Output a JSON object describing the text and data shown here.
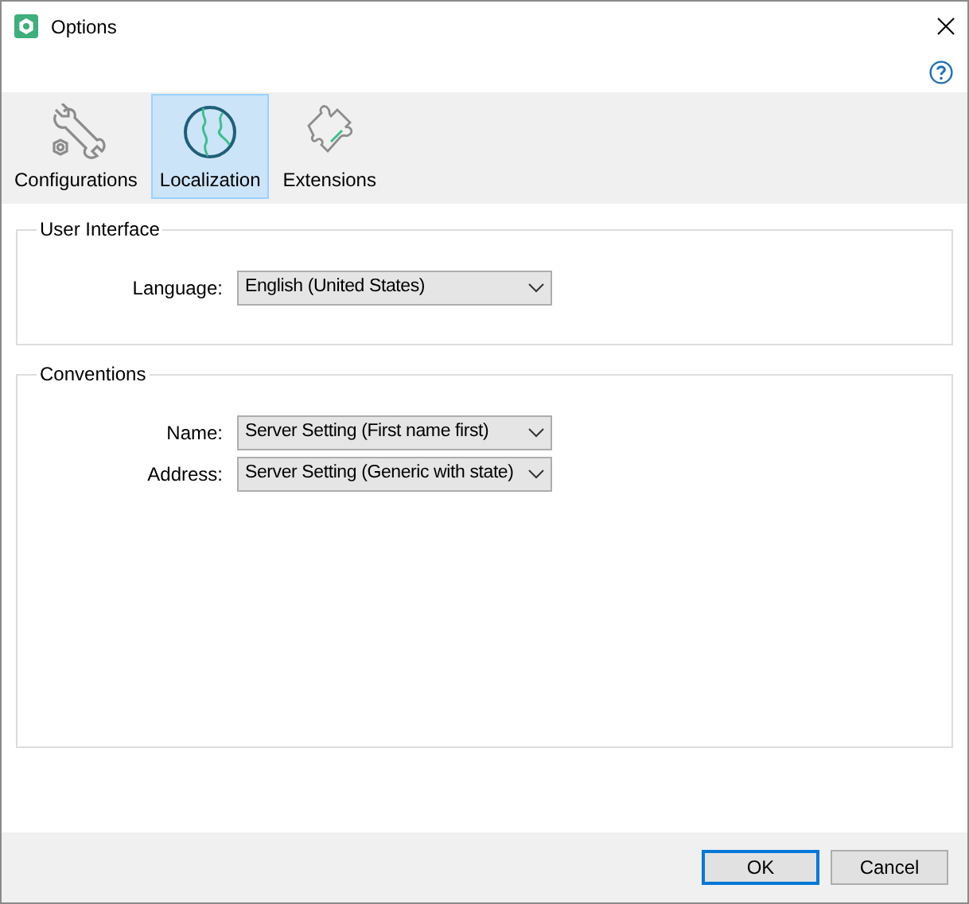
{
  "window": {
    "title": "Options"
  },
  "tabs": [
    {
      "label": "Configurations",
      "kind": "wrench",
      "selected": false
    },
    {
      "label": "Localization",
      "kind": "globe",
      "selected": true
    },
    {
      "label": "Extensions",
      "kind": "puzzle",
      "selected": false
    }
  ],
  "groups": [
    {
      "title": "User Interface",
      "fields": [
        {
          "label": "Language:",
          "value": "English (United States)"
        }
      ]
    },
    {
      "title": "Conventions",
      "fields": [
        {
          "label": "Name:",
          "value": "Server Setting (First name first)"
        },
        {
          "label": "Address:",
          "value": "Server Setting (Generic with state)"
        }
      ]
    }
  ],
  "buttons": [
    {
      "label": "OK",
      "default": true
    },
    {
      "label": "Cancel",
      "default": false
    }
  ]
}
